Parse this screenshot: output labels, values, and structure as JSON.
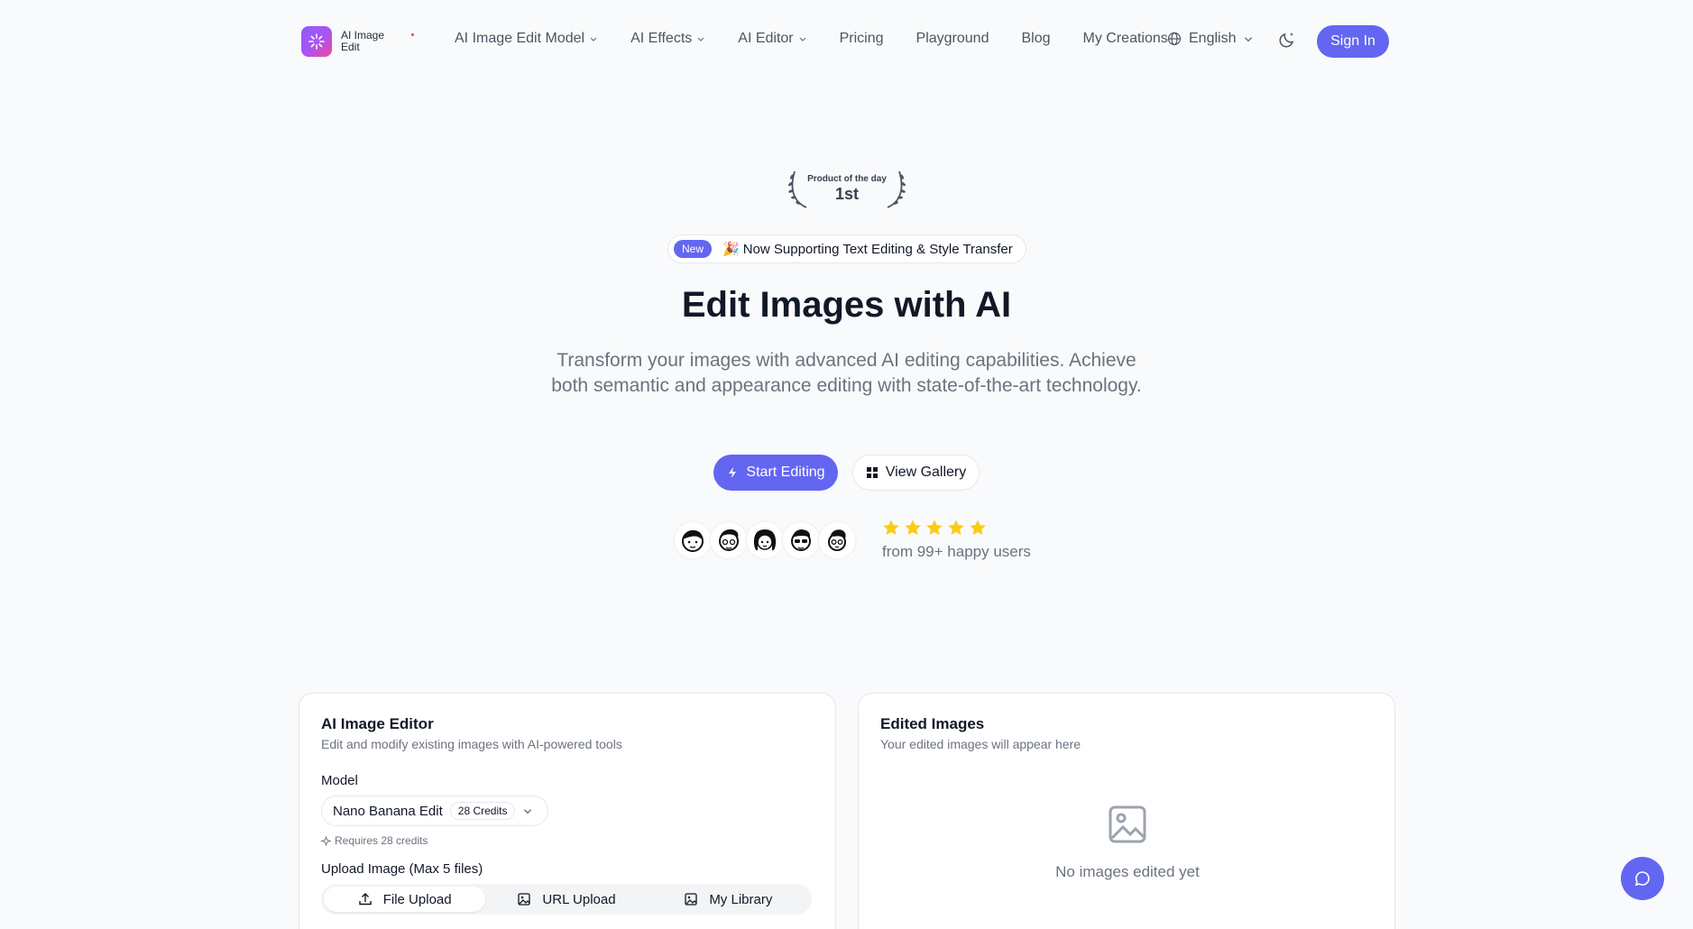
{
  "brand": {
    "name": "AI Image Edit"
  },
  "nav": {
    "items": [
      {
        "label": "AI Image Edit Model",
        "dropdown": true
      },
      {
        "label": "AI Effects",
        "dropdown": true
      },
      {
        "label": "AI Editor",
        "dropdown": true
      },
      {
        "label": "Pricing",
        "dropdown": false
      },
      {
        "label": "Playground",
        "dropdown": false
      },
      {
        "label": "Blog",
        "dropdown": false
      },
      {
        "label": "My Creations",
        "dropdown": false
      }
    ],
    "language": "English",
    "sign_in": "Sign In"
  },
  "hero": {
    "award_small": "Product of the day",
    "award_big": "1st",
    "announce_badge": "New",
    "announce_emoji": "🎉",
    "announce_text": "Now Supporting Text Editing & Style Transfer",
    "title": "Edit Images with AI",
    "subtitle": "Transform your images with advanced AI editing capabilities. Achieve both semantic and appearance editing with state-of-the-art technology.",
    "primary_cta": "Start Editing",
    "secondary_cta": "View Gallery",
    "rating": 5,
    "happy_users": "from 99+ happy users"
  },
  "editor": {
    "title": "AI Image Editor",
    "description": "Edit and modify existing images with AI-powered tools",
    "model_label": "Model",
    "model_value": "Nano Banana Edit",
    "model_credits": "28 Credits",
    "requires": "Requires 28 credits",
    "upload_label": "Upload Image (Max 5 files)",
    "upload_tabs": [
      "File Upload",
      "URL Upload",
      "My Library"
    ]
  },
  "results": {
    "title": "Edited Images",
    "description": "Your edited images will appear here",
    "empty_text": "No images edited yet"
  },
  "colors": {
    "accent": "#6366f1",
    "star": "#facc15"
  }
}
